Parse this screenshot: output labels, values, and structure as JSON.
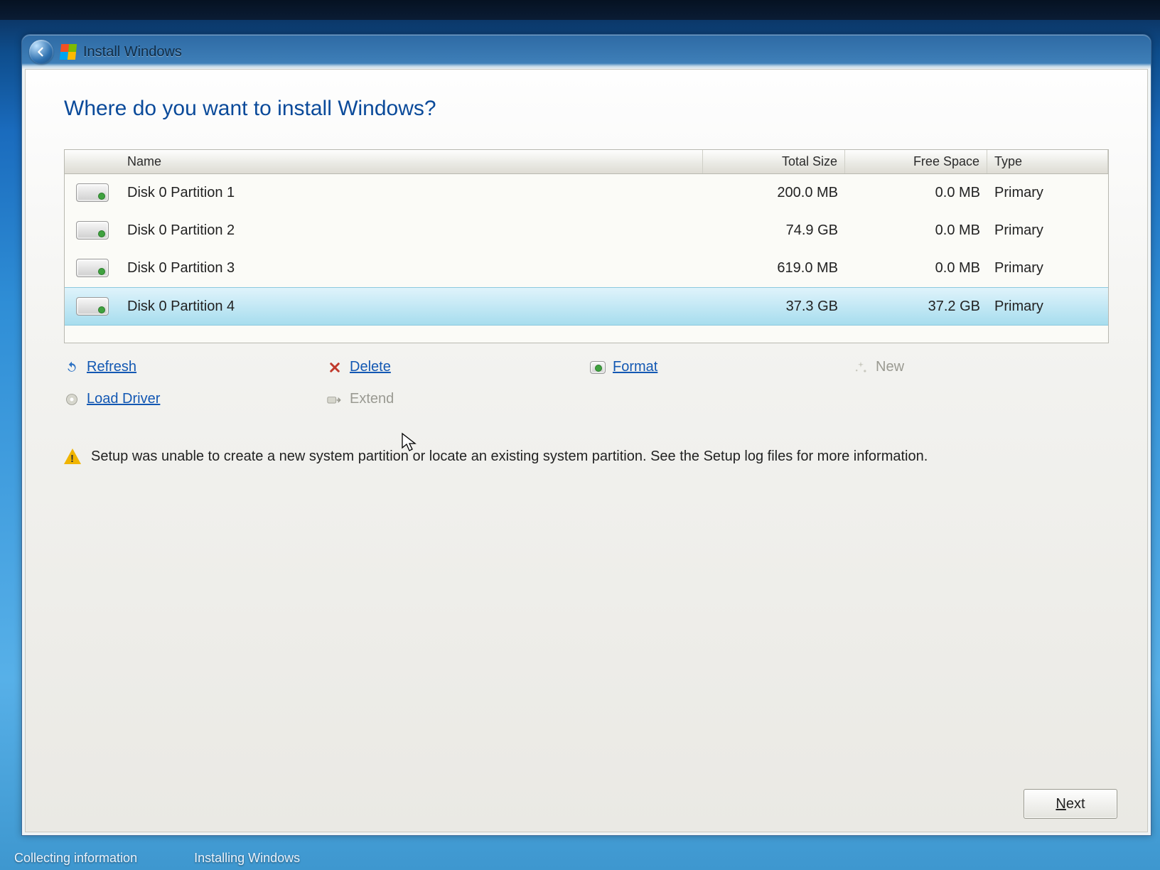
{
  "window": {
    "title": "Install Windows"
  },
  "heading": "Where do you want to install Windows?",
  "columns": {
    "name": "Name",
    "total": "Total Size",
    "free": "Free Space",
    "type": "Type"
  },
  "rows": [
    {
      "name": "Disk 0 Partition 1",
      "total": "200.0 MB",
      "free": "0.0 MB",
      "type": "Primary",
      "selected": false
    },
    {
      "name": "Disk 0 Partition 2",
      "total": "74.9 GB",
      "free": "0.0 MB",
      "type": "Primary",
      "selected": false
    },
    {
      "name": "Disk 0 Partition 3",
      "total": "619.0 MB",
      "free": "0.0 MB",
      "type": "Primary",
      "selected": false
    },
    {
      "name": "Disk 0 Partition 4",
      "total": "37.3 GB",
      "free": "37.2 GB",
      "type": "Primary",
      "selected": true
    }
  ],
  "tools": {
    "refresh": "Refresh",
    "delete": "Delete",
    "format": "Format",
    "new": "New",
    "load_driver": "Load Driver",
    "extend": "Extend"
  },
  "warning": "Setup was unable to create a new system partition or locate an existing system partition. See the Setup log files for more information.",
  "buttons": {
    "next": "Next"
  },
  "taskbar": {
    "left": "Collecting information",
    "right": "Installing Windows"
  }
}
